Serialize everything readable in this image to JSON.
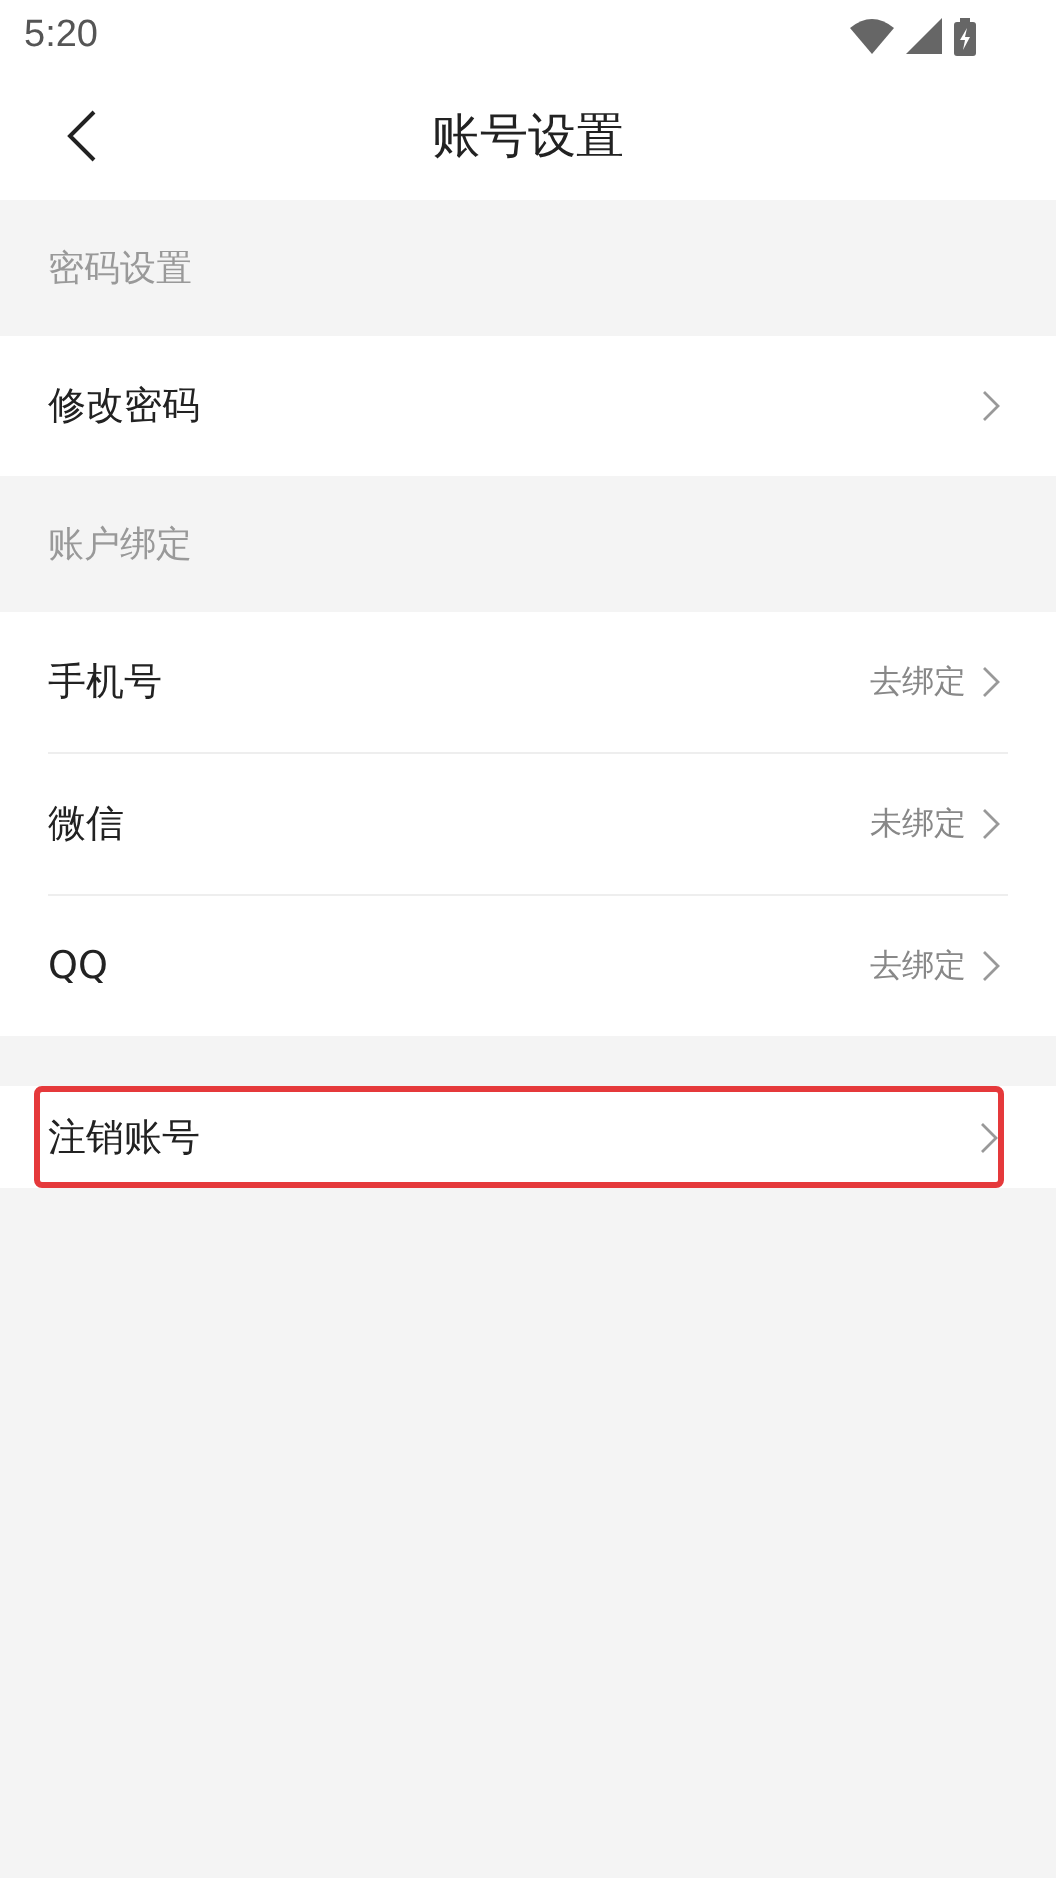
{
  "status_bar": {
    "time": "5:20"
  },
  "header": {
    "title": "账号设置"
  },
  "sections": [
    {
      "title": "密码设置",
      "rows": [
        {
          "label": "修改密码"
        }
      ]
    },
    {
      "title": "账户绑定",
      "rows": [
        {
          "label": "手机号",
          "value": "去绑定"
        },
        {
          "label": "微信",
          "value": "未绑定"
        },
        {
          "label": "QQ",
          "value": "去绑定"
        }
      ]
    },
    {
      "rows": [
        {
          "label": "注销账号",
          "highlighted": true
        }
      ]
    }
  ]
}
